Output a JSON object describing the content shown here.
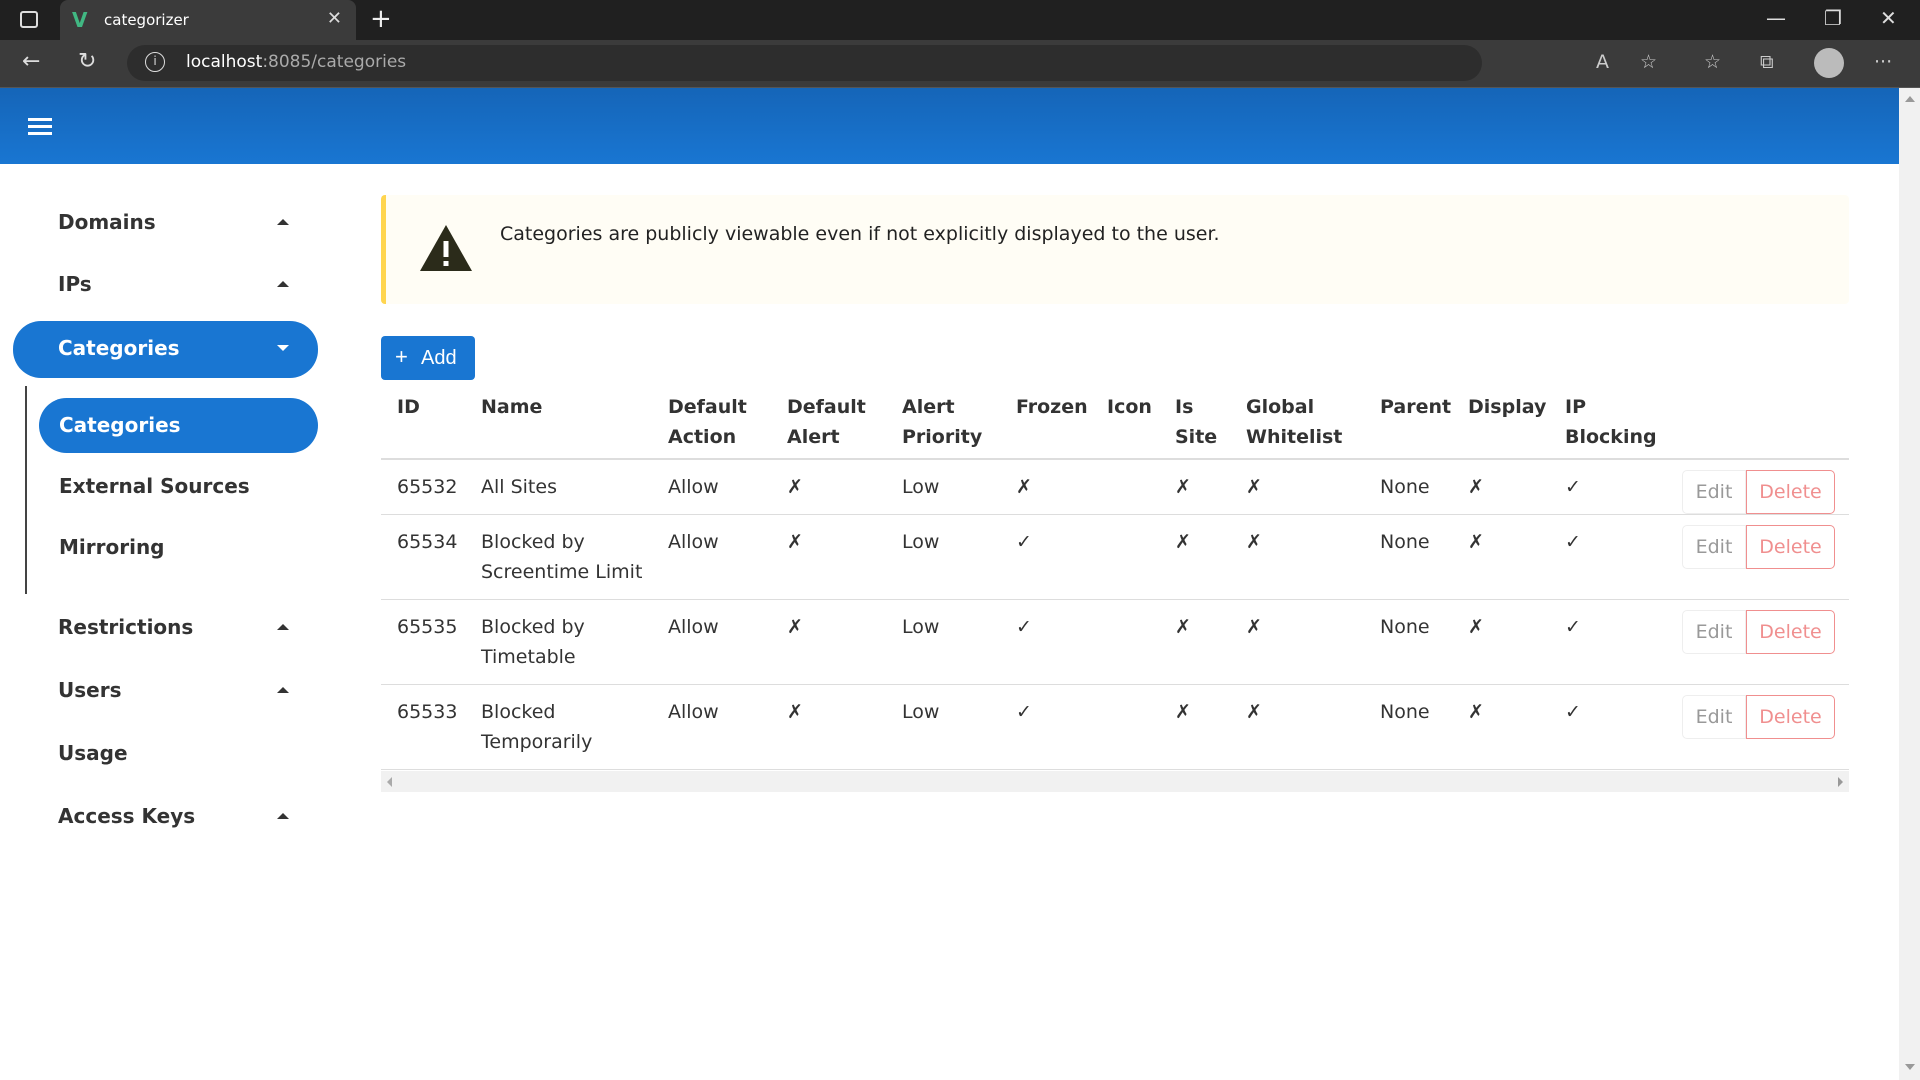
{
  "browser": {
    "tab_title": "categorizer",
    "url_host": "localhost",
    "url_path": ":8085/categories"
  },
  "colors": {
    "primary": "#1976d2",
    "warning": "#ffd54f",
    "danger": "#f08f8f"
  },
  "sidebar": {
    "items": [
      {
        "label": "Domains",
        "caret": "up"
      },
      {
        "label": "IPs",
        "caret": "up"
      },
      {
        "label": "Categories",
        "caret": "down",
        "active": true
      },
      {
        "label": "Restrictions",
        "caret": "up"
      },
      {
        "label": "Users",
        "caret": "up"
      },
      {
        "label": "Usage"
      },
      {
        "label": "Access Keys",
        "caret": "up"
      }
    ],
    "sub_items": [
      {
        "label": "Categories",
        "active": true
      },
      {
        "label": "External Sources"
      },
      {
        "label": "Mirroring"
      }
    ]
  },
  "alert": {
    "icon": "warning-triangle-icon",
    "message": "Categories are publicly viewable even if not explicitly displayed to the user."
  },
  "add_button": {
    "label": "Add",
    "icon": "plus-icon"
  },
  "table": {
    "headers": [
      "ID",
      "Name",
      "Default Action",
      "Default Alert",
      "Alert Priority",
      "Frozen",
      "Icon",
      "Is Site",
      "Global Whitelist",
      "Parent",
      "Display",
      "IP Blocking"
    ],
    "rows": [
      [
        "65532",
        "All Sites",
        "Allow",
        "✗",
        "Low",
        "✗",
        "",
        "✗",
        "✗",
        "None",
        "✗",
        "✓"
      ],
      [
        "65534",
        "Blocked by Screentime Limit",
        "Allow",
        "✗",
        "Low",
        "✓",
        "",
        "✗",
        "✗",
        "None",
        "✗",
        "✓"
      ],
      [
        "65535",
        "Blocked by Timetable",
        "Allow",
        "✗",
        "Low",
        "✓",
        "",
        "✗",
        "✗",
        "None",
        "✗",
        "✓"
      ],
      [
        "65533",
        "Blocked Temporarily",
        "Allow",
        "✗",
        "Low",
        "✓",
        "",
        "✗",
        "✗",
        "None",
        "✗",
        "✓"
      ]
    ],
    "edit_label": "Edit",
    "delete_label": "Delete"
  }
}
